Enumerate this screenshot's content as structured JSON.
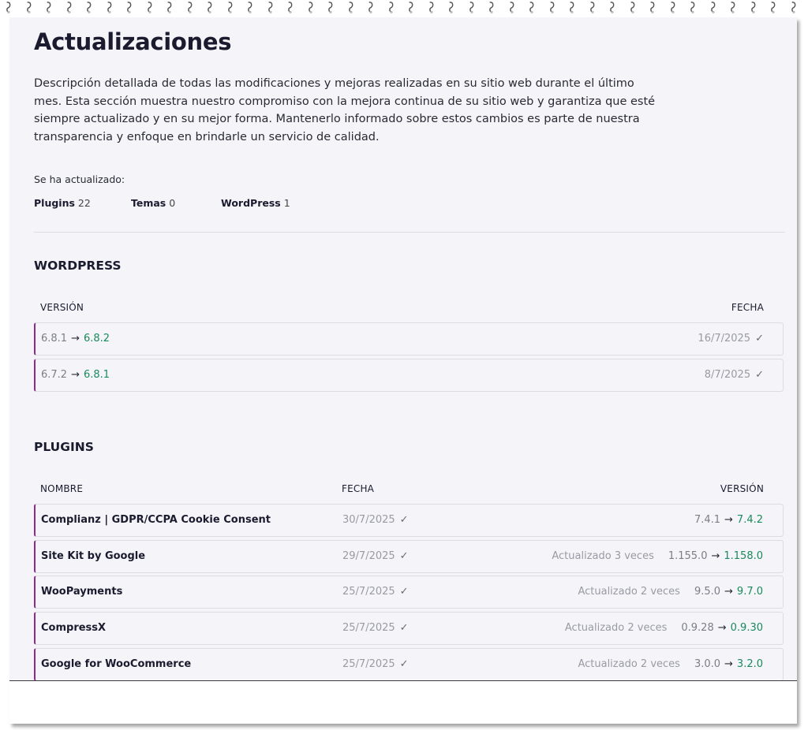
{
  "page": {
    "title": "Actualizaciones",
    "description": "Descripción detallada de todas las modificaciones y mejoras realizadas en su sitio web durante el último mes. Esta sección muestra nuestro compromiso con la mejora continua de su sitio web y garantiza que esté siempre actualizado y en su mejor forma. Mantenerlo informado sobre estos cambios es parte de nuestra transparencia y enfoque en brindarle un servicio de calidad."
  },
  "summary": {
    "label": "Se ha actualizado:",
    "items": [
      {
        "label": "Plugins",
        "count": "22"
      },
      {
        "label": "Temas",
        "count": "0"
      },
      {
        "label": "WordPress",
        "count": "1"
      }
    ]
  },
  "wordpress": {
    "heading": "WORDPRESS",
    "col_version": "VERSIÓN",
    "col_date": "FECHA",
    "rows": [
      {
        "from": "6.8.1",
        "to": "6.8.2",
        "date": "16/7/2025"
      },
      {
        "from": "6.7.2",
        "to": "6.8.1",
        "date": "8/7/2025"
      }
    ]
  },
  "plugins": {
    "heading": "PLUGINS",
    "col_name": "NOMBRE",
    "col_date": "FECHA",
    "col_version": "VERSIÓN",
    "rows": [
      {
        "name": "Complianz | GDPR/CCPA Cookie Consent",
        "date": "30/7/2025",
        "times": "",
        "from": "7.4.1",
        "to": "7.4.2"
      },
      {
        "name": "Site Kit by Google",
        "date": "29/7/2025",
        "times": "Actualizado 3 veces",
        "from": "1.155.0",
        "to": "1.158.0"
      },
      {
        "name": "WooPayments",
        "date": "25/7/2025",
        "times": "Actualizado 2 veces",
        "from": "9.5.0",
        "to": "9.7.0"
      },
      {
        "name": "CompressX",
        "date": "25/7/2025",
        "times": "Actualizado 2 veces",
        "from": "0.9.28",
        "to": "0.9.30"
      },
      {
        "name": "Google for WooCommerce",
        "date": "25/7/2025",
        "times": "Actualizado 2 veces",
        "from": "3.0.0",
        "to": "3.2.0"
      }
    ]
  },
  "icons": {
    "arrow": "arrow-right-icon",
    "check": "check-icon"
  },
  "colors": {
    "accent": "#8b2a8f",
    "new_version": "#1a8a5a",
    "background": "#f4f4f9"
  }
}
